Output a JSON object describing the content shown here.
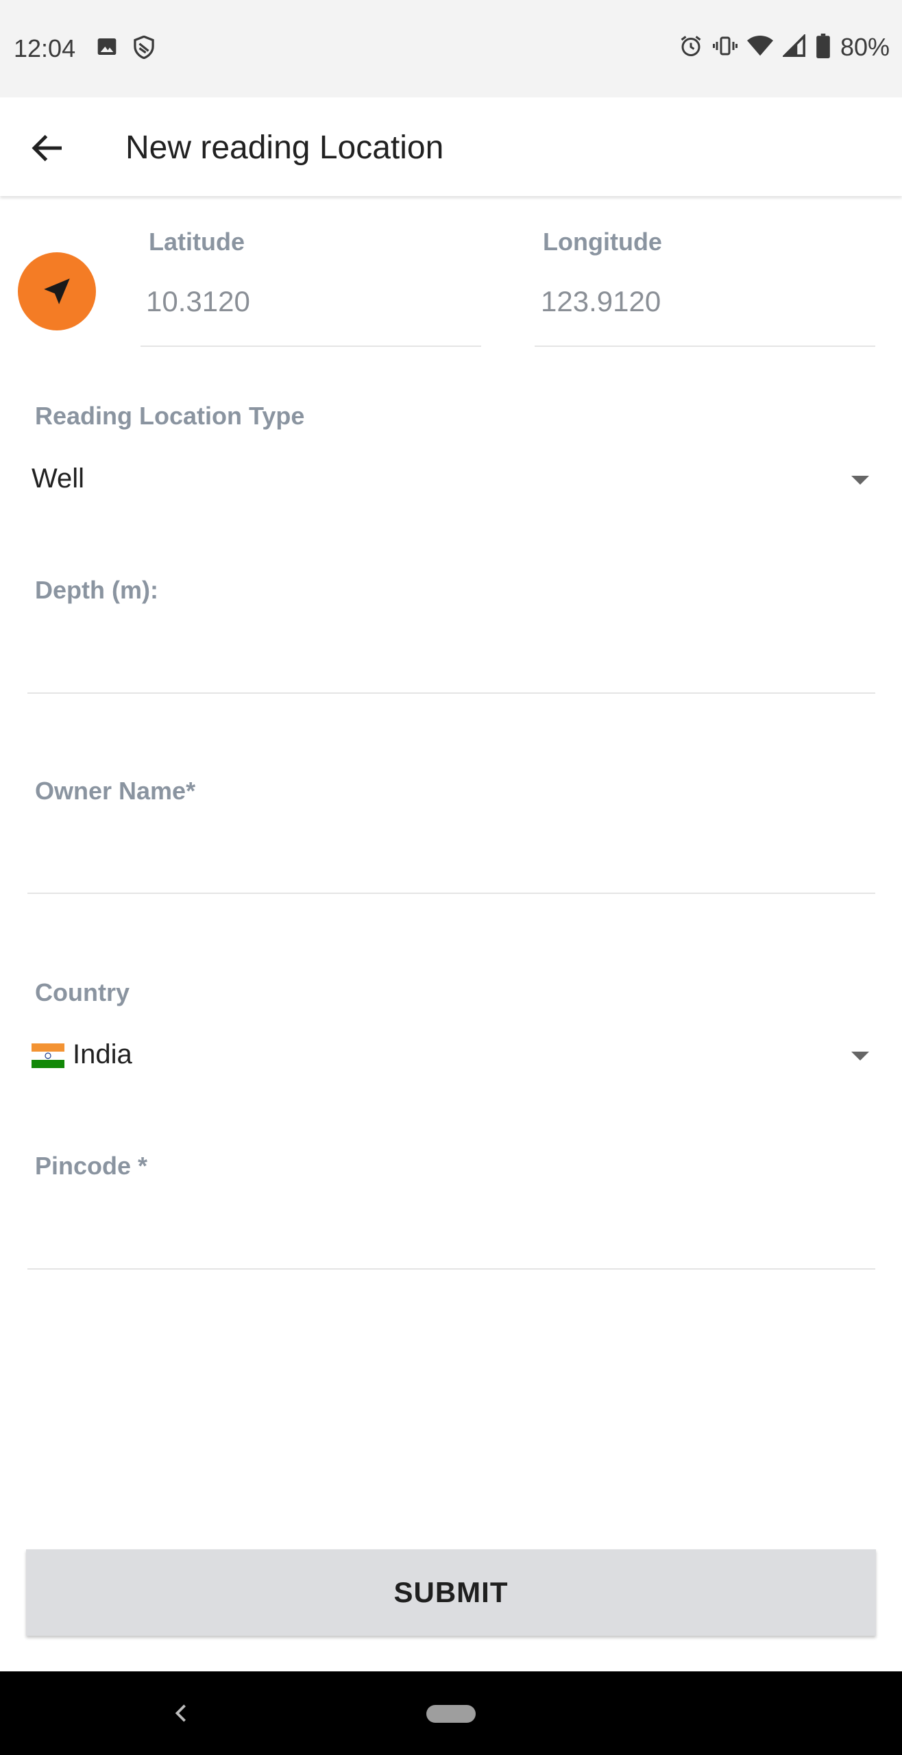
{
  "status_bar": {
    "time": "12:04",
    "battery": "80%",
    "left_icons": [
      "image-icon",
      "shield-icon"
    ],
    "right_icons": [
      "alarm-icon",
      "vibrate-icon",
      "wifi-icon",
      "signal-icon",
      "battery-icon"
    ]
  },
  "app_bar": {
    "title": "New reading Location",
    "back_icon": "arrow-left-icon"
  },
  "location": {
    "locate_icon": "navigation-arrow-icon",
    "latitude_label": "Latitude",
    "latitude_value": "10.3120",
    "longitude_label": "Longitude",
    "longitude_value": "123.9120"
  },
  "form": {
    "reading_type_label": "Reading Location Type",
    "reading_type_value": "Well",
    "depth_label": "Depth (m):",
    "depth_value": "",
    "owner_label": "Owner Name*",
    "owner_value": "",
    "country_label": "Country",
    "country_value": "India",
    "country_flag": "india-flag-icon",
    "pincode_label": "Pincode *",
    "pincode_value": ""
  },
  "actions": {
    "submit_label": "SUBMIT"
  },
  "colors": {
    "accent": "#f47c25",
    "label": "#8a94a0",
    "button_bg": "#dcdde0"
  }
}
